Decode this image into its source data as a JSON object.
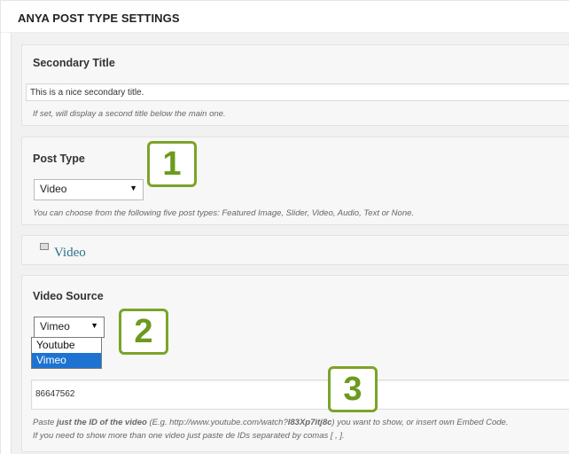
{
  "header": {
    "title": "ANYA POST TYPE SETTINGS"
  },
  "secondary_title": {
    "label": "Secondary Title",
    "value": "This is a nice secondary title.",
    "description": "If set, will display a second title below the main one."
  },
  "post_type": {
    "label": "Post Type",
    "selected": "Video",
    "description": "You can choose from the following five post types: Featured Image, Slider, Video, Audio, Text or None."
  },
  "video_section": {
    "title": "Video"
  },
  "video_source": {
    "label": "Video Source",
    "selected": "Vimeo",
    "options": [
      "Youtube",
      "Vimeo"
    ]
  },
  "video_id": {
    "value": "86647562",
    "desc_pre": "Paste ",
    "desc_bold": "just the ID of the video",
    "desc_mid": " (E.g. http://www.youtube.com/watch?",
    "desc_bold2": "l83Xp7itj8c",
    "desc_post": ") you want to show, or insert own Embed Code.",
    "desc_line2": "If you need to show more than one video just paste de IDs separated by comas [ , ]."
  },
  "badges": [
    "1",
    "2",
    "3"
  ],
  "colors": {
    "accent_green": "#7ba428",
    "link_blue": "#2a6f8d",
    "selection_blue": "#1e73d2"
  }
}
